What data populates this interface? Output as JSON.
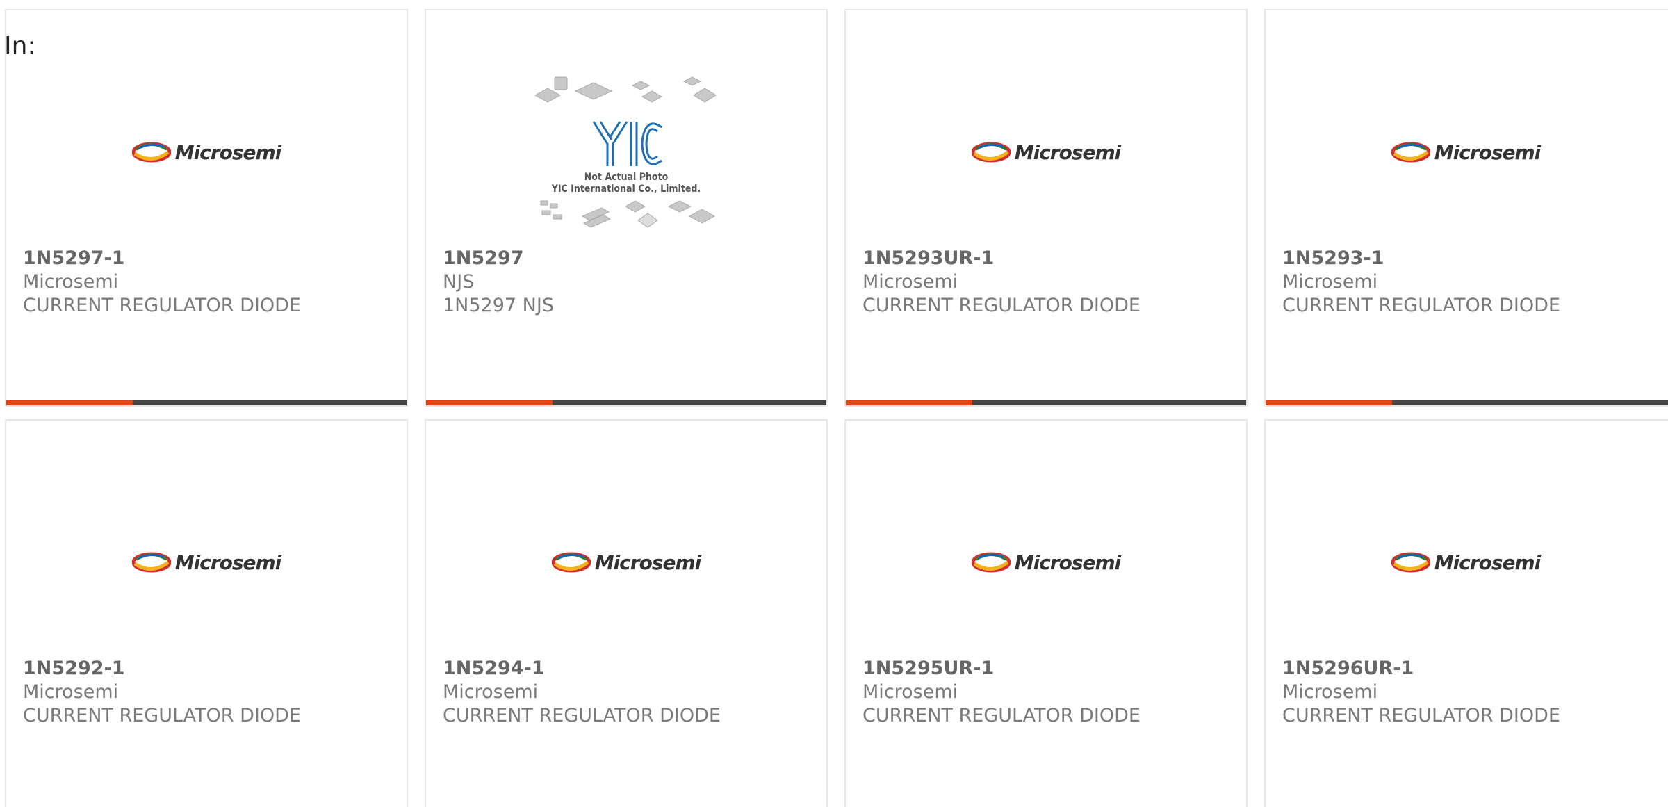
{
  "heading": "In:",
  "colors": {
    "accent": "#e8400f",
    "bar": "#444444",
    "border": "#e6e6e6"
  },
  "logos": {
    "microsemi": "Microsemi",
    "yic_caption_1": "Not Actual Photo",
    "yic_caption_2": "YIC International Co., Limited.",
    "yic_mark": "YIC"
  },
  "products": [
    {
      "part": "1N5297-1",
      "manufacturer": "Microsemi",
      "description": "CURRENT REGULATOR DIODE",
      "image": "microsemi-logo"
    },
    {
      "part": "1N5297",
      "manufacturer": "NJS",
      "description": "1N5297 NJS",
      "image": "yic-not-actual-photo"
    },
    {
      "part": "1N5293UR-1",
      "manufacturer": "Microsemi",
      "description": "CURRENT REGULATOR DIODE",
      "image": "microsemi-logo"
    },
    {
      "part": "1N5293-1",
      "manufacturer": "Microsemi",
      "description": "CURRENT REGULATOR DIODE",
      "image": "microsemi-logo"
    },
    {
      "part": "1N5292-1",
      "manufacturer": "Microsemi",
      "description": "CURRENT REGULATOR DIODE",
      "image": "microsemi-logo"
    },
    {
      "part": "1N5294-1",
      "manufacturer": "Microsemi",
      "description": "CURRENT REGULATOR DIODE",
      "image": "microsemi-logo"
    },
    {
      "part": "1N5295UR-1",
      "manufacturer": "Microsemi",
      "description": "CURRENT REGULATOR DIODE",
      "image": "microsemi-logo"
    },
    {
      "part": "1N5296UR-1",
      "manufacturer": "Microsemi",
      "description": "CURRENT REGULATOR DIODE",
      "image": "microsemi-logo"
    }
  ]
}
